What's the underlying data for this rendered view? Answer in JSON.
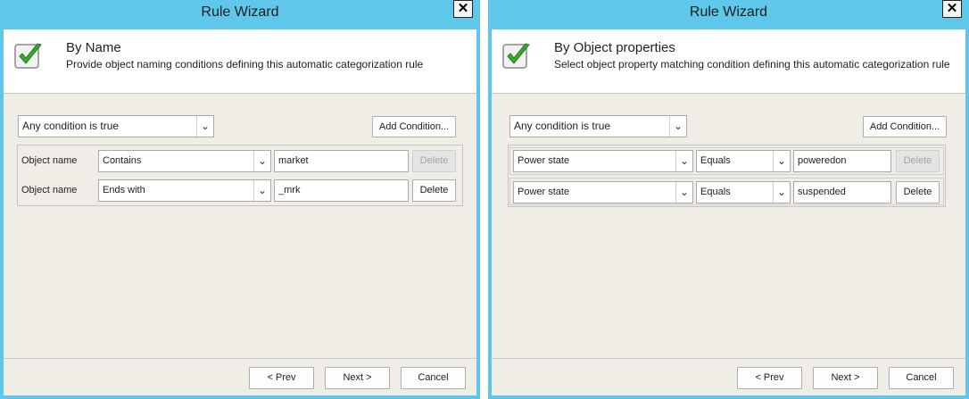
{
  "left": {
    "title": "Rule Wizard",
    "close_symbol": "✕",
    "header_title": "By Name",
    "header_desc": "Provide object naming conditions defining this automatic categorization rule",
    "condition_mode": "Any condition is true",
    "add_condition": "Add Condition...",
    "rows": [
      {
        "field": "Object name",
        "operator": "Contains",
        "value": "market",
        "delete": "Delete",
        "delete_enabled": false
      },
      {
        "field": "Object name",
        "operator": "Ends with",
        "value": "_mrk",
        "delete": "Delete",
        "delete_enabled": true
      }
    ],
    "prev": "< Prev",
    "next": "Next >",
    "cancel": "Cancel"
  },
  "right": {
    "title": "Rule Wizard",
    "close_symbol": "✕",
    "header_title": "By Object properties",
    "header_desc": "Select object property matching condition defining this automatic categorization rule",
    "condition_mode": "Any condition is true",
    "add_condition": "Add Condition...",
    "rows": [
      {
        "property": "Power state",
        "operator": "Equals",
        "value": "poweredon",
        "delete": "Delete",
        "delete_enabled": false
      },
      {
        "property": "Power state",
        "operator": "Equals",
        "value": "suspended",
        "delete": "Delete",
        "delete_enabled": true
      }
    ],
    "prev": "< Prev",
    "next": "Next >",
    "cancel": "Cancel"
  },
  "icons": {
    "check": "checkmark-icon",
    "close": "close-icon",
    "dropdown": "chevron-down-icon"
  },
  "colors": {
    "titlebar": "#5fc7ea",
    "check_green": "#3aa832",
    "panel": "#efede6"
  }
}
